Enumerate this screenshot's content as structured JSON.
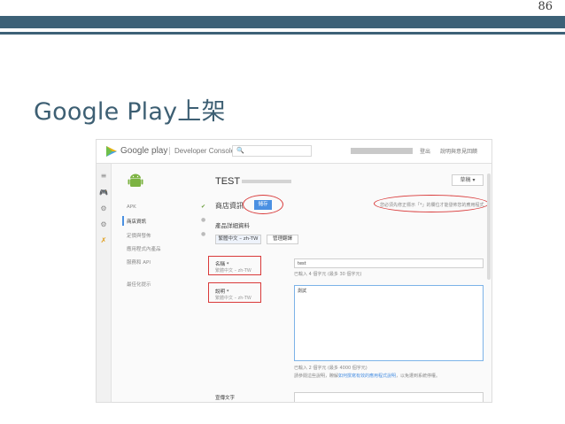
{
  "slide": {
    "page_number": "86",
    "title": "Google Play上架"
  },
  "console": {
    "brand": "Google play",
    "product": "Developer Console",
    "search_icon": "🔍",
    "logout": "登出",
    "help": "說明與意見回饋"
  },
  "rail_icons": [
    "≡",
    "🎮",
    "⚙",
    "⚙",
    "✗"
  ],
  "nav": {
    "items": [
      {
        "label": "APK",
        "status": "check"
      },
      {
        "label": "商店資訊",
        "status": "dot",
        "active": true
      },
      {
        "label": "定價與發佈",
        "status": "dot"
      },
      {
        "label": "應用程式內產品",
        "status": ""
      },
      {
        "label": "服務和 API",
        "status": ""
      },
      {
        "label": "最佳化提示",
        "status": ""
      }
    ]
  },
  "main": {
    "app_title": "TEST",
    "publish_button": "草稿 ▾",
    "section_title": "商店資訊",
    "save_button": "儲存",
    "hint": "您必須先修正標示「*」的欄位才能發佈您的應用程式",
    "product_details": "產品詳細資料",
    "lang_primary": "繁體中文 – zh-TW",
    "lang_manage": "管理翻譯",
    "name_label": "名稱 *",
    "name_lang": "繁體中文 – zh-TW",
    "name_value": "test",
    "name_count": "已輸入 4 個字元 (最多 30 個字元)",
    "desc_label": "說明 *",
    "desc_lang": "繁體中文 – zh-TW",
    "desc_value": "測試",
    "desc_count": "已輸入 2 個字元 (最多 4000 個字元)",
    "desc_help": "請參閱這些說明，瞭解",
    "desc_help_link": "如何撰寫有效的應用程式說明",
    "desc_help_tail": "，以免遭到系統停權。",
    "promo_label": "宣傳文字"
  },
  "colors": {
    "slide_accent": "#3d6177",
    "title_color": "#3d5f73",
    "annotation_red": "#d93a3a",
    "button_blue": "#4a90e2",
    "android_green": "#7cb342"
  }
}
